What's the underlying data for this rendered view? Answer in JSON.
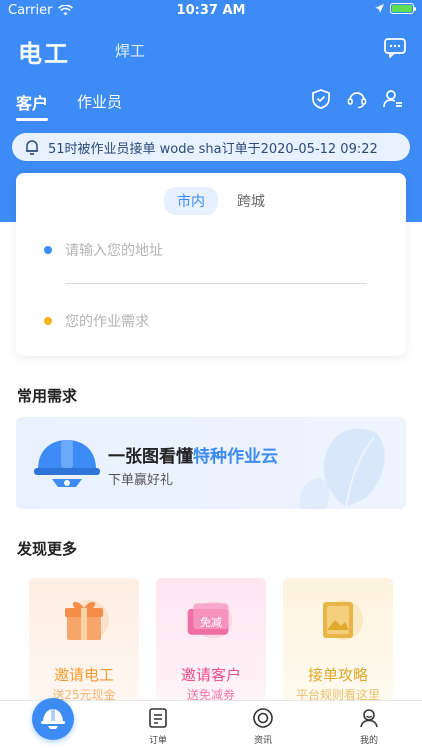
{
  "status_bar": {
    "carrier": "Carrier",
    "time": "10:37 AM"
  },
  "header": {
    "title": "电工",
    "subtitle": "焊工"
  },
  "tabs": {
    "active": "客户",
    "second": "作业员"
  },
  "notice": {
    "text": "51时被作业员接单   wode sha订单于2020-05-12 09:22"
  },
  "address_card": {
    "segments": [
      "市内",
      "跨城"
    ],
    "address_placeholder": "请输入您的地址",
    "need_placeholder": "您的作业需求"
  },
  "sections": {
    "common": "常用需求",
    "discover": "发现更多"
  },
  "banner": {
    "title_plain": "一张图看懂",
    "title_highlight": "特种作业云",
    "subtitle": "下单赢好礼"
  },
  "discover_cards": [
    {
      "title": "邀请电工",
      "subtitle": "送25元现金"
    },
    {
      "title": "邀请客户",
      "subtitle": "送免减券",
      "art_label": "免减"
    },
    {
      "title": "接单攻略",
      "subtitle": "平台规则看这里"
    }
  ],
  "tabbar": {
    "items": [
      "订单",
      "资讯",
      "我的"
    ]
  },
  "colors": {
    "brand": "#3d8bf5",
    "orange": "#f29b2e",
    "pink": "#ea4d8a",
    "gold": "#e0a92c"
  }
}
